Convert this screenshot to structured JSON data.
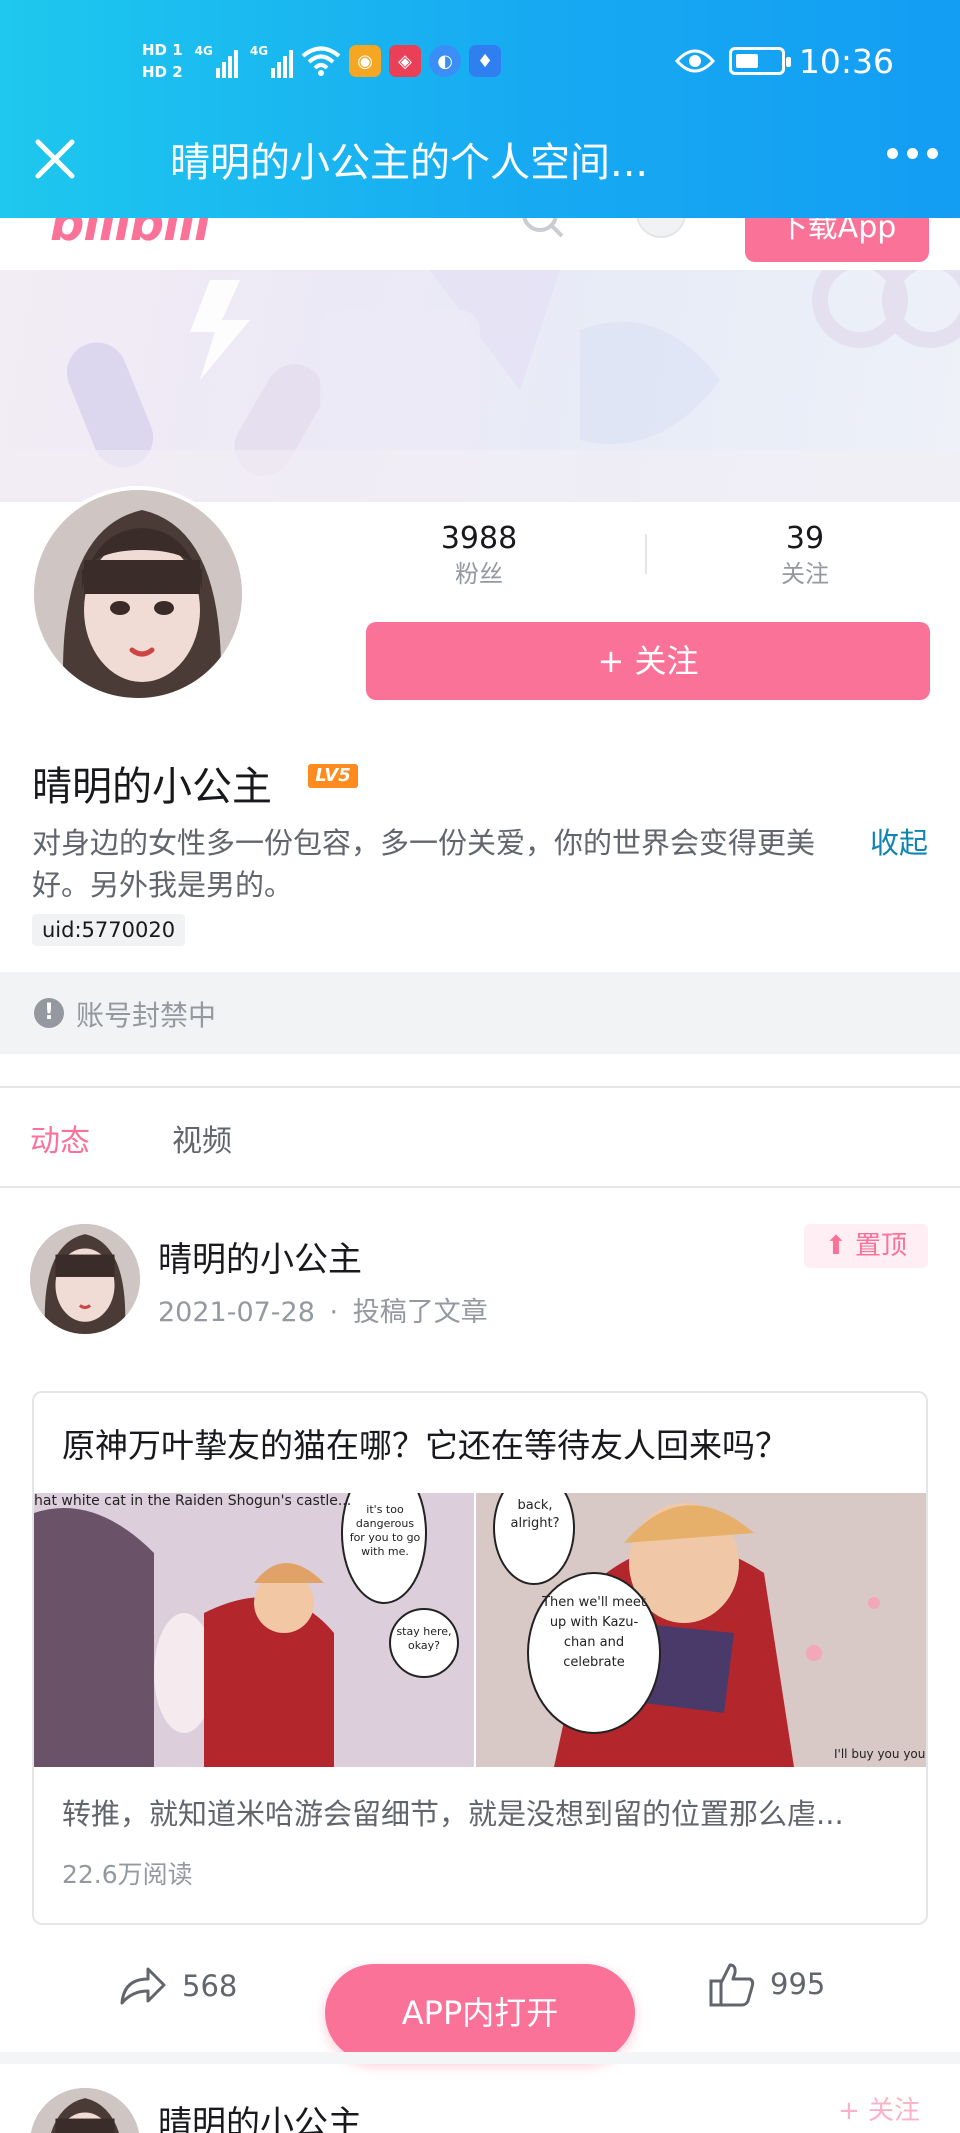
{
  "status_bar": {
    "hd1": "HD 1",
    "hd2": "HD 2",
    "network1": "4G",
    "network2": "4G",
    "time": "10:36",
    "battery_level": 0.5,
    "icons": [
      "signal-icon",
      "wifi-icon",
      "weibo-icon",
      "app-icon",
      "bulb-icon",
      "eye-icon",
      "battery-icon"
    ]
  },
  "header": {
    "title": "晴明的小公主的个人空间...",
    "close_icon": "close-icon",
    "more_icon": "more-icon"
  },
  "site_header": {
    "logo": "bilibili",
    "download_button": "下载App"
  },
  "profile": {
    "followers": "3988",
    "followers_label": "粉丝",
    "following": "39",
    "following_label": "关注",
    "follow_button": "+ 关注",
    "username": "晴明的小公主",
    "level": "LV5",
    "signature": "对身边的女性多一份包容，多一份关爱，你的世界会变得更美好。另外我是男的。",
    "collapse_label": "收起",
    "uid": "uid:5770020",
    "ban_notice": "账号封禁中"
  },
  "tabs": [
    {
      "label": "动态",
      "active": true
    },
    {
      "label": "视频",
      "active": false
    }
  ],
  "post": {
    "author": "晴明的小公主",
    "date": "2021-07-28",
    "action": "投稿了文章",
    "separator": "·",
    "pinned_label": "置顶",
    "article": {
      "title": "原神万叶挚友的猫在哪？它还在等待友人回来吗？",
      "description": "转推，就知道米哈游会留细节，就是没想到留的位置那么虐...",
      "reads": "22.6万阅读",
      "comic_text": {
        "caption": "hat white cat in the Raiden Shogun's castle...",
        "bubble1": "it's too dangerous for you to go with me.",
        "bubble2": "stay here, okay?",
        "bubble3": "back, alright?",
        "bubble4": "Then we'll meet up with Kazu-chan and celebrate",
        "bubble5": "I'll buy you your"
      }
    },
    "shares": "568",
    "likes": "995"
  },
  "open_app_button": "APP内打开",
  "next_post": {
    "author": "晴明的小公主",
    "follow_hint": "+ 关注"
  },
  "colors": {
    "brand_pink": "#fb7299",
    "header_blue": "#17aaf2",
    "link_blue": "#0e86b3",
    "level_orange": "#ff8b1f"
  }
}
